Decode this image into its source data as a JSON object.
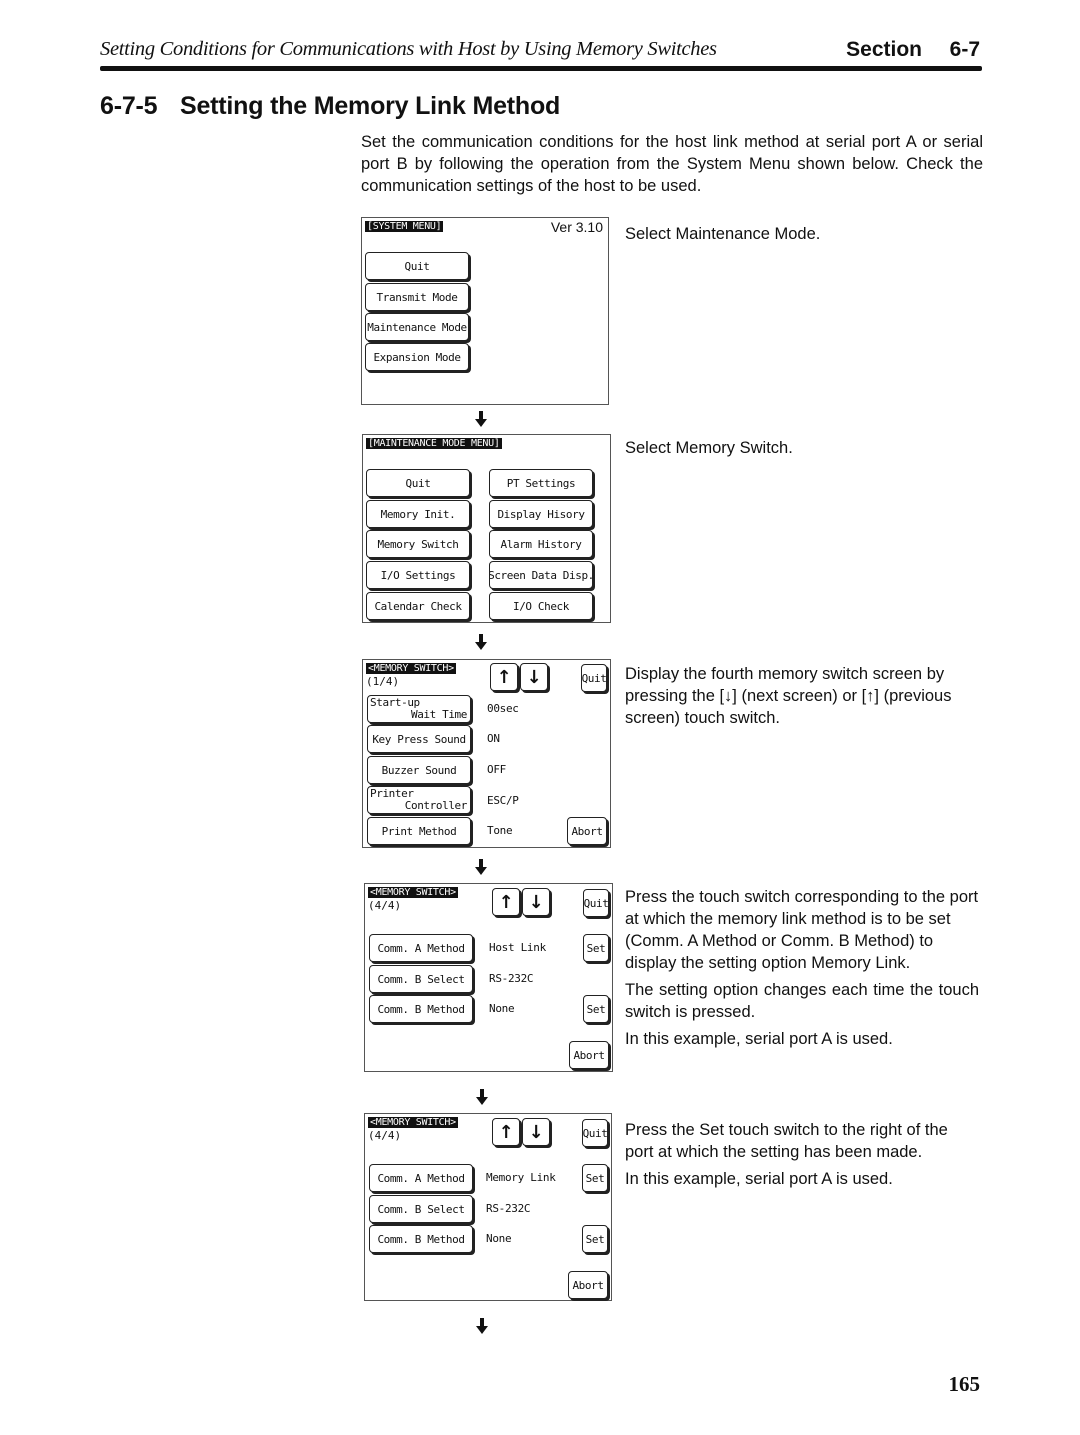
{
  "header": {
    "running_title": "Setting Conditions for Communications with Host by Using Memory Switches",
    "section_label": "Section",
    "section_number": "6-7"
  },
  "heading": {
    "number": "6-7-5",
    "title": "Setting the Memory Link Method"
  },
  "intro": "Set the communication conditions for the host link method at serial port A or serial port B by following the operation from the System Menu shown below. Check the communication settings of the host to be used.",
  "steps": [
    {
      "description": [
        "Select Maintenance Mode."
      ],
      "screen": {
        "title": "[SYSTEM MENU]",
        "version": "Ver 3.10",
        "buttons": [
          "Quit",
          "Transmit Mode",
          "Maintenance Mode",
          "Expansion Mode"
        ]
      }
    },
    {
      "description": [
        "Select Memory Switch."
      ],
      "screen": {
        "title": "[MAINTENANCE MODE MENU]",
        "left_buttons": [
          "Quit",
          "Memory Init.",
          "Memory Switch",
          "I/O Settings",
          "Calendar Check"
        ],
        "right_buttons": [
          "PT Settings",
          "Display Hisory",
          "Alarm History",
          "Screen Data Disp.",
          "I/O Check"
        ]
      }
    },
    {
      "description": [
        "Display the fourth memory switch screen by pressing the [↓] (next screen) or [↑] (previous screen) touch switch."
      ],
      "screen": {
        "title": "<MEMORY SWITCH>",
        "page": "(1/4)",
        "up_icon": "↑",
        "down_icon": "↓",
        "quit": "Quit",
        "abort": "Abort",
        "rows": [
          {
            "label_line1": "Start-up",
            "label_line2": "Wait Time",
            "value": "00sec"
          },
          {
            "label": "Key Press Sound",
            "value": "ON"
          },
          {
            "label": "Buzzer Sound",
            "value": "OFF"
          },
          {
            "label_line1": "Printer",
            "label_line2": "Controller",
            "value": "ESC/P"
          },
          {
            "label": "Print Method",
            "value": "Tone"
          }
        ]
      }
    },
    {
      "description": [
        "Press the touch switch corresponding to the port at which the memory link method is to be set (Comm. A Method or Comm. B Method) to display the setting option Memory Link.",
        "The setting option changes each time the touch switch is pressed.",
        "In this example, serial port A is used."
      ],
      "screen": {
        "title": "<MEMORY SWITCH>",
        "page": "(4/4)",
        "up_icon": "↑",
        "down_icon": "↓",
        "quit": "Quit",
        "abort": "Abort",
        "set": "Set",
        "rows": [
          {
            "label": "Comm. A Method",
            "value": "Host Link"
          },
          {
            "label": "Comm. B Select",
            "value": "RS-232C"
          },
          {
            "label": "Comm. B Method",
            "value": "None"
          }
        ]
      }
    },
    {
      "description": [
        "Press the Set touch switch to the right of the port at which the setting has been made.",
        "In this example, serial port A is used."
      ],
      "screen": {
        "title": "<MEMORY SWITCH>",
        "page": "(4/4)",
        "up_icon": "↑",
        "down_icon": "↓",
        "quit": "Quit",
        "abort": "Abort",
        "set": "Set",
        "rows": [
          {
            "label": "Comm. A Method",
            "value": "Memory Link"
          },
          {
            "label": "Comm. B Select",
            "value": "RS-232C"
          },
          {
            "label": "Comm. B Method",
            "value": "None"
          }
        ]
      }
    }
  ],
  "flow_arrow_icon": "down-arrow",
  "page_number": "165"
}
